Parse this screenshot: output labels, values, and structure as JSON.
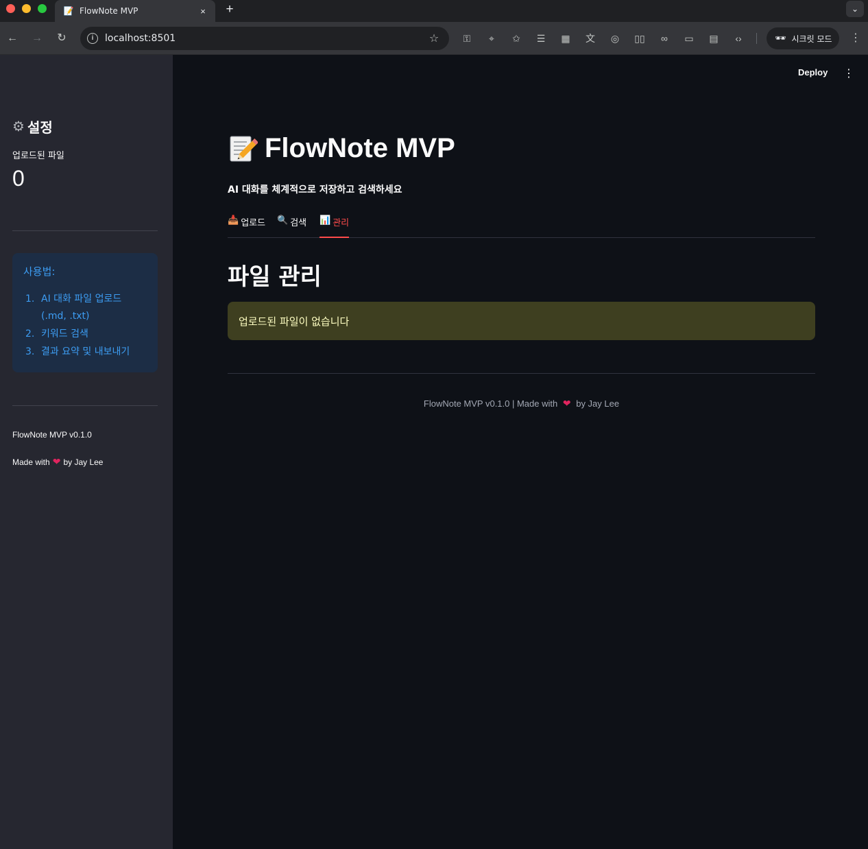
{
  "browser": {
    "tab_title": "FlowNote MVP",
    "tab_close": "×",
    "new_tab": "+",
    "url": "localhost:8501",
    "incognito_label": "시크릿 모드",
    "traffic_colors": [
      "#ff5f57",
      "#febc2e",
      "#28c840"
    ]
  },
  "sidebar": {
    "title": "설정",
    "metric_label": "업로드된 파일",
    "metric_value": "0",
    "info_title": "사용법:",
    "steps": [
      {
        "num": "1.",
        "text": "AI 대화 파일 업로드 (.md, .txt)"
      },
      {
        "num": "2.",
        "text": "키워드 검색"
      },
      {
        "num": "3.",
        "text": "결과 요약 및 내보내기"
      }
    ],
    "version": "FlowNote MVP v0.1.0",
    "made_prefix": "Made with",
    "made_suffix": "by Jay Lee"
  },
  "header": {
    "deploy_label": "Deploy"
  },
  "main": {
    "title": "FlowNote MVP",
    "subtitle": "AI 대화를 체계적으로 저장하고 검색하세요",
    "tabs": [
      {
        "label": "업로드",
        "icon": "inbox-tray-icon",
        "active": false
      },
      {
        "label": "검색",
        "icon": "magnifier-icon",
        "active": false
      },
      {
        "label": "관리",
        "icon": "bar-chart-icon",
        "active": true
      }
    ],
    "section_title": "파일 관리",
    "warning": "업로드된 파일이 없습니다",
    "footer_prefix": "FlowNote MVP v0.1.0 | Made with",
    "footer_suffix": "by Jay Lee"
  },
  "colors": {
    "accent": "#ff4b4b",
    "info_text": "#3d9df3",
    "warning_bg": "#3e3f20",
    "warning_text": "#ffffc2"
  }
}
